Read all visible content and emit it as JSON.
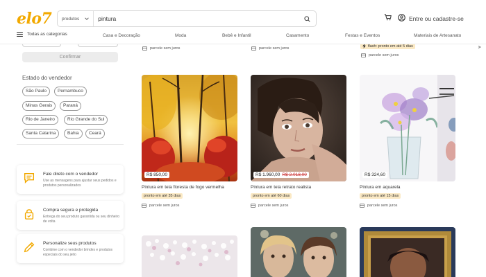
{
  "header": {
    "logo": "elo7",
    "search_scope": "produtos",
    "search_value": "pintura",
    "login_label": "Entre ou cadastre-se"
  },
  "nav": {
    "all_categories": "Todas as categorias",
    "items": [
      "Casa e Decoração",
      "Moda",
      "Bebê e Infantil",
      "Casamento",
      "Festas e Eventos",
      "Materiais de Artesanato"
    ]
  },
  "sidebar": {
    "confirm_label": "Confirmar",
    "seller_state_title": "Estado do vendedor",
    "states": [
      "São Paulo",
      "Pernambuco",
      "Minas Gerais",
      "Paraná",
      "Rio de Janeiro",
      "Rio Grande do Sul",
      "Santa Catarina",
      "Bahia",
      "Ceará"
    ],
    "promos": [
      {
        "title": "Fale direto com o vendedor",
        "desc": "Use as mensagens para ajustar seus pedidos e produtos personalizados",
        "icon": "chat-icon"
      },
      {
        "title": "Compra segura e protegida",
        "desc": "Entrega do seu produto garantida ou seu dinheiro de volta",
        "icon": "lock-icon"
      },
      {
        "title": "Personalize seus produtos",
        "desc": "Combine com o vendedor brindes e produtos especiais do seu jeito",
        "icon": "pencil-icon"
      }
    ]
  },
  "top_row": {
    "pix_1": "parcele sem juros",
    "pix_2": "parcele sem juros",
    "flash": "flash: pronto em até 5 dias",
    "pix_3": "parcele sem juros"
  },
  "products": [
    {
      "title": "Pintura em tela floresta de fogo vermelha",
      "price": "R$ 850,00",
      "old_price": "",
      "shipping": "pronto em até 35 dias",
      "installments": "parcele sem juros"
    },
    {
      "title": "Pintura em tela retrato realista",
      "price": "R$ 1.960,00",
      "old_price": "R$ 2.018,00",
      "shipping": "pronto em até 60 dias",
      "installments": "parcele sem juros"
    },
    {
      "title": "Pintura em aquarela",
      "price": "R$ 324,60",
      "old_price": "",
      "shipping": "pronto em até 15 dias",
      "installments": "parcele sem juros"
    }
  ],
  "colors": {
    "brand": "#f2a900",
    "badge_bg": "#fbe9c4",
    "old_price": "#cc3333"
  }
}
